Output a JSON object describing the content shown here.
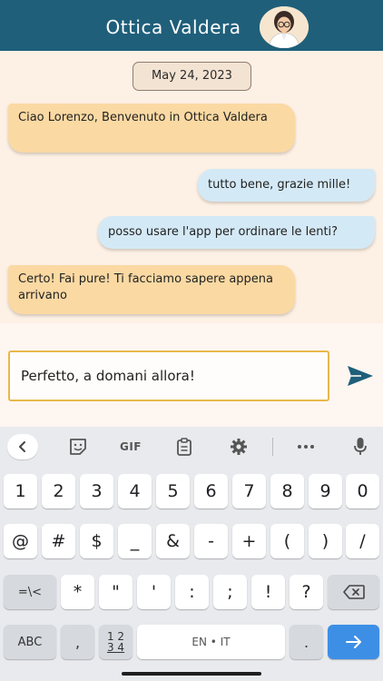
{
  "header": {
    "title": "Ottica Valdera",
    "color": "#1f5f7a"
  },
  "chat": {
    "date": "May 24, 2023",
    "messages": [
      {
        "side": "received",
        "text": "Ciao Lorenzo, Benvenuto in Ottica Valdera"
      },
      {
        "side": "sent",
        "text": "tutto bene, grazie mille!"
      },
      {
        "side": "sent",
        "text": "posso usare l'app per ordinare le lenti?"
      },
      {
        "side": "received",
        "text": "Certo! Fai pure! Ti facciamo sapere appena arrivano"
      }
    ],
    "received_color": "#fbd9a3",
    "sent_color": "#d4e9f6"
  },
  "composer": {
    "input_value": "Perfetto, a domani allora!",
    "send_icon": "send-icon"
  },
  "keyboard": {
    "toolbar": {
      "back_icon": "chevron-left-icon",
      "sticker_icon": "sticker-icon",
      "gif_label": "GIF",
      "clipboard_icon": "clipboard-icon",
      "settings_icon": "gear-icon",
      "more_icon": "more-icon",
      "mic_icon": "microphone-icon"
    },
    "row1": [
      "1",
      "2",
      "3",
      "4",
      "5",
      "6",
      "7",
      "8",
      "9",
      "0"
    ],
    "row2": [
      "@",
      "#",
      "$",
      "_",
      "&",
      "-",
      "+",
      "(",
      ")",
      "/"
    ],
    "row3": [
      "=\\<",
      "*",
      "\"",
      "'",
      ":",
      ";",
      "!",
      "?"
    ],
    "row4": {
      "abc": "ABC",
      "comma": ",",
      "numpad_top": "1 2",
      "numpad_bottom": "3 4",
      "space": "EN • IT",
      "period": ".",
      "enter_icon": "arrow-right-icon"
    },
    "accent": "#3d8fe6"
  }
}
